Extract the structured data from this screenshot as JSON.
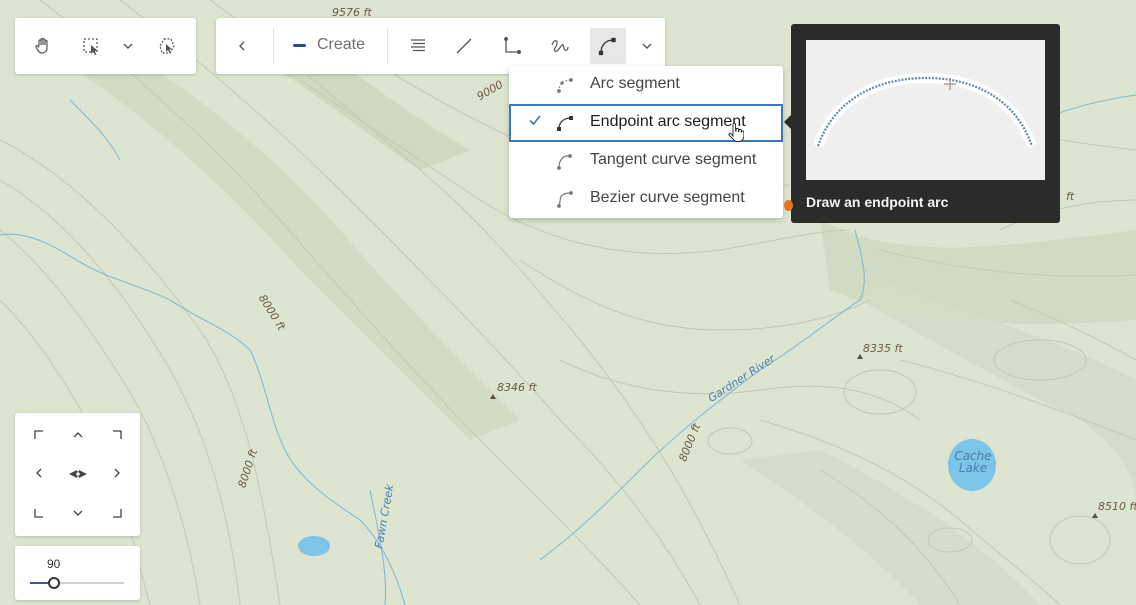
{
  "map": {
    "labels": {
      "elev_top": "9576 ft",
      "contour_9000": "9000",
      "contour_8000_a": "8000 ft",
      "contour_8000_b": "8000 ft",
      "contour_8000_c": "8000 ft",
      "spot_8346": "8346 ft",
      "spot_8335": "8335 ft",
      "spot_8510": "8510 ft",
      "edge_ft": "ft",
      "river": "Gardner River",
      "creek": "Fawn Creek",
      "lake_line1": "Cache",
      "lake_line2": "Lake"
    }
  },
  "toolbar_left": {
    "pan_icon": "hand-icon",
    "select_icon": "rectangle-select-icon",
    "expand_icon": "chevron-down-icon",
    "lasso_icon": "lasso-select-icon"
  },
  "toolbar_main": {
    "back_icon": "chevron-left-icon",
    "create_label": "Create",
    "tools": [
      "list-icon",
      "line-segment-icon",
      "right-angle-icon",
      "freehand-icon",
      "endpoint-arc-icon"
    ],
    "more_icon": "chevron-down-icon"
  },
  "segment_menu": {
    "items": [
      {
        "label": "Arc segment",
        "icon": "arc-segment-icon",
        "selected": false
      },
      {
        "label": "Endpoint arc segment",
        "icon": "endpoint-arc-icon",
        "selected": true
      },
      {
        "label": "Tangent curve segment",
        "icon": "tangent-curve-icon",
        "selected": false
      },
      {
        "label": "Bezier curve segment",
        "icon": "bezier-curve-icon",
        "selected": false
      }
    ]
  },
  "tooltip": {
    "text": "Draw an endpoint arc",
    "preview": "endpoint-arc-preview"
  },
  "navigator": {
    "buttons": [
      "pan-up-left-icon",
      "pan-up-icon",
      "pan-up-right-icon",
      "pan-left-icon",
      "rotate-icon",
      "pan-right-icon",
      "pan-down-left-icon",
      "pan-down-icon",
      "pan-down-right-icon"
    ]
  },
  "zoom": {
    "value": "90",
    "fraction": 0.26
  },
  "colors": {
    "accent": "#3b78b6",
    "create_dash": "#2e4c82",
    "tooltip_bg": "#2b2b2b",
    "map_bg": "#dce4cf",
    "water": "#7cc4e8"
  }
}
